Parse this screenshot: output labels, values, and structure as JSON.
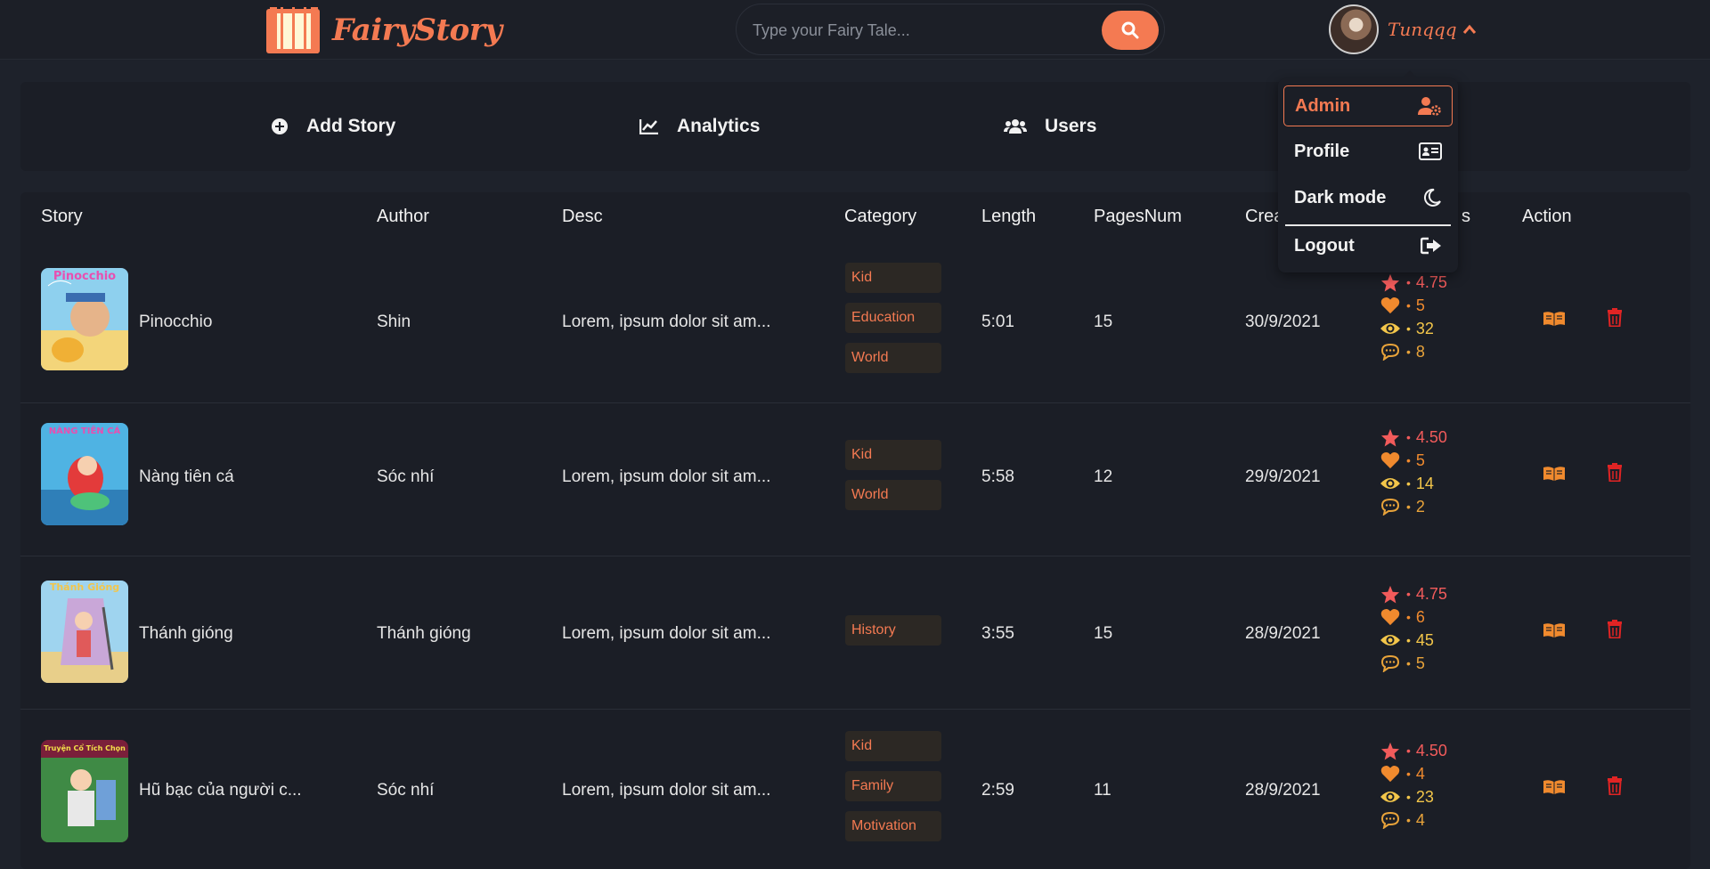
{
  "header": {
    "logo_text": "FairyStory",
    "search_placeholder": "Type your Fairy Tale...",
    "user_name": "Tunqqq"
  },
  "actions": [
    {
      "label": "Add Story",
      "icon": "plus-circle-icon"
    },
    {
      "label": "Analytics",
      "icon": "chart-line-icon"
    },
    {
      "label": "Users",
      "icon": "users-icon"
    }
  ],
  "dropdown": {
    "items": [
      {
        "label": "Admin",
        "icon": "user-gear-icon",
        "active": true
      },
      {
        "label": "Profile",
        "icon": "id-card-icon"
      },
      {
        "label": "Dark mode",
        "icon": "moon-icon"
      },
      {
        "label": "Logout",
        "icon": "sign-out-icon"
      }
    ]
  },
  "table": {
    "headers": [
      "Story",
      "Author",
      "Desc",
      "Category",
      "Length",
      "PagesNum",
      "Crea",
      "s",
      "Action"
    ],
    "rows": [
      {
        "title": "Pinocchio",
        "cover_text": "Pinocchio",
        "author": "Shin",
        "desc": "Lorem, ipsum dolor sit am...",
        "categories": [
          "Kid",
          "Education",
          "World"
        ],
        "length": "5:01",
        "pages": "15",
        "created": "30/9/2021",
        "rating": "4.75",
        "likes": "5",
        "views": "32",
        "comments": "8"
      },
      {
        "title": "Nàng tiên cá",
        "cover_text": "NÀNG TIÊN CÁ",
        "author": "Sóc nhí",
        "desc": "Lorem, ipsum dolor sit am...",
        "categories": [
          "Kid",
          "World"
        ],
        "length": "5:58",
        "pages": "12",
        "created": "29/9/2021",
        "rating": "4.50",
        "likes": "5",
        "views": "14",
        "comments": "2"
      },
      {
        "title": "Thánh gióng",
        "cover_text": "Thánh Gióng",
        "author": "Thánh gióng",
        "desc": "Lorem, ipsum dolor sit am...",
        "categories": [
          "History"
        ],
        "length": "3:55",
        "pages": "15",
        "created": "28/9/2021",
        "rating": "4.75",
        "likes": "6",
        "views": "45",
        "comments": "5"
      },
      {
        "title": "Hũ bạc của người c...",
        "cover_text": "Truyện Cổ Tích Chọn",
        "author": "Sóc nhí",
        "desc": "Lorem, ipsum dolor sit am...",
        "categories": [
          "Kid",
          "Family",
          "Motivation"
        ],
        "length": "2:59",
        "pages": "11",
        "created": "28/9/2021",
        "rating": "4.50",
        "likes": "4",
        "views": "23",
        "comments": "4"
      }
    ]
  },
  "colors": {
    "accent": "#f47a52",
    "rating": "#f25b5b",
    "like": "#f08a2e",
    "view": "#f3c64a",
    "comment": "#e8a33a",
    "delete": "#e02424"
  }
}
